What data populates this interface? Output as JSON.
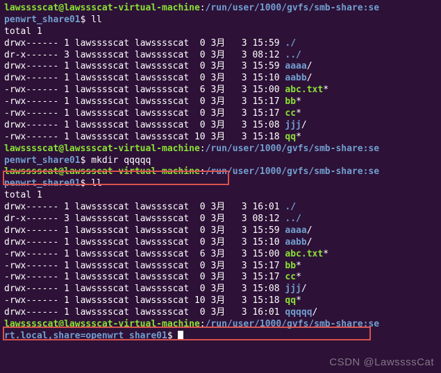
{
  "prompt": {
    "user": "lawsssscat",
    "host": "lawssscat-virtual-machine",
    "path_short": "/run/user/1000/gvfs/smb-share:se",
    "path_cont": "penwrt_share01",
    "path_full_cont": "rt.local,share=openwrt_share01",
    "dollar": "$ "
  },
  "cmds": {
    "ll": "ll",
    "mkdir": "mkdir qqqqq"
  },
  "total": "total 1",
  "listing1": [
    {
      "perm": "drwx------",
      "links": "1",
      "owner": "lawsssscat",
      "group": "lawsssscat",
      "size": " 0",
      "month": "3月",
      "day": "  3",
      "time": "15:59",
      "name": "./",
      "cls": "blue"
    },
    {
      "perm": "dr-x------",
      "links": "3",
      "owner": "lawsssscat",
      "group": "lawsssscat",
      "size": " 0",
      "month": "3月",
      "day": "  3",
      "time": "08:12",
      "name": "../",
      "cls": "blue"
    },
    {
      "perm": "drwx------",
      "links": "1",
      "owner": "lawsssscat",
      "group": "lawsssscat",
      "size": " 0",
      "month": "3月",
      "day": "  3",
      "time": "15:59",
      "name": "aaaa",
      "suffix": "/",
      "cls": "blue"
    },
    {
      "perm": "drwx------",
      "links": "1",
      "owner": "lawsssscat",
      "group": "lawsssscat",
      "size": " 0",
      "month": "3月",
      "day": "  3",
      "time": "15:10",
      "name": "aabb",
      "suffix": "/",
      "cls": "blue"
    },
    {
      "perm": "-rwx------",
      "links": "1",
      "owner": "lawsssscat",
      "group": "lawsssscat",
      "size": " 6",
      "month": "3月",
      "day": "  3",
      "time": "15:00",
      "name": "abc.txt",
      "suffix": "*",
      "cls": "green-exec"
    },
    {
      "perm": "-rwx------",
      "links": "1",
      "owner": "lawsssscat",
      "group": "lawsssscat",
      "size": " 0",
      "month": "3月",
      "day": "  3",
      "time": "15:17",
      "name": "bb",
      "suffix": "*",
      "cls": "green-exec"
    },
    {
      "perm": "-rwx------",
      "links": "1",
      "owner": "lawsssscat",
      "group": "lawsssscat",
      "size": " 0",
      "month": "3月",
      "day": "  3",
      "time": "15:17",
      "name": "cc",
      "suffix": "*",
      "cls": "green-exec"
    },
    {
      "perm": "drwx------",
      "links": "1",
      "owner": "lawsssscat",
      "group": "lawsssscat",
      "size": " 0",
      "month": "3月",
      "day": "  3",
      "time": "15:08",
      "name": "jjj",
      "suffix": "/",
      "cls": "blue"
    },
    {
      "perm": "-rwx------",
      "links": "1",
      "owner": "lawsssscat",
      "group": "lawsssscat",
      "size": "10",
      "month": "3月",
      "day": "  3",
      "time": "15:18",
      "name": "qq",
      "suffix": "*",
      "cls": "green-exec"
    }
  ],
  "listing2": [
    {
      "perm": "drwx------",
      "links": "1",
      "owner": "lawsssscat",
      "group": "lawsssscat",
      "size": " 0",
      "month": "3月",
      "day": "  3",
      "time": "16:01",
      "name": "./",
      "cls": "blue"
    },
    {
      "perm": "dr-x------",
      "links": "3",
      "owner": "lawsssscat",
      "group": "lawsssscat",
      "size": " 0",
      "month": "3月",
      "day": "  3",
      "time": "08:12",
      "name": "../",
      "cls": "blue"
    },
    {
      "perm": "drwx------",
      "links": "1",
      "owner": "lawsssscat",
      "group": "lawsssscat",
      "size": " 0",
      "month": "3月",
      "day": "  3",
      "time": "15:59",
      "name": "aaaa",
      "suffix": "/",
      "cls": "blue"
    },
    {
      "perm": "drwx------",
      "links": "1",
      "owner": "lawsssscat",
      "group": "lawsssscat",
      "size": " 0",
      "month": "3月",
      "day": "  3",
      "time": "15:10",
      "name": "aabb",
      "suffix": "/",
      "cls": "blue"
    },
    {
      "perm": "-rwx------",
      "links": "1",
      "owner": "lawsssscat",
      "group": "lawsssscat",
      "size": " 6",
      "month": "3月",
      "day": "  3",
      "time": "15:00",
      "name": "abc.txt",
      "suffix": "*",
      "cls": "green-exec"
    },
    {
      "perm": "-rwx------",
      "links": "1",
      "owner": "lawsssscat",
      "group": "lawsssscat",
      "size": " 0",
      "month": "3月",
      "day": "  3",
      "time": "15:17",
      "name": "bb",
      "suffix": "*",
      "cls": "green-exec"
    },
    {
      "perm": "-rwx------",
      "links": "1",
      "owner": "lawsssscat",
      "group": "lawsssscat",
      "size": " 0",
      "month": "3月",
      "day": "  3",
      "time": "15:17",
      "name": "cc",
      "suffix": "*",
      "cls": "green-exec"
    },
    {
      "perm": "drwx------",
      "links": "1",
      "owner": "lawsssscat",
      "group": "lawsssscat",
      "size": " 0",
      "month": "3月",
      "day": "  3",
      "time": "15:08",
      "name": "jjj",
      "suffix": "/",
      "cls": "blue"
    },
    {
      "perm": "-rwx------",
      "links": "1",
      "owner": "lawsssscat",
      "group": "lawsssscat",
      "size": "10",
      "month": "3月",
      "day": "  3",
      "time": "15:18",
      "name": "qq",
      "suffix": "*",
      "cls": "green-exec"
    },
    {
      "perm": "drwx------",
      "links": "1",
      "owner": "lawsssscat",
      "group": "lawsssscat",
      "size": " 0",
      "month": "3月",
      "day": "  3",
      "time": "16:01",
      "name": "qqqqq",
      "suffix": "/",
      "cls": "blue"
    }
  ],
  "watermark": "CSDN @LawssssCat"
}
